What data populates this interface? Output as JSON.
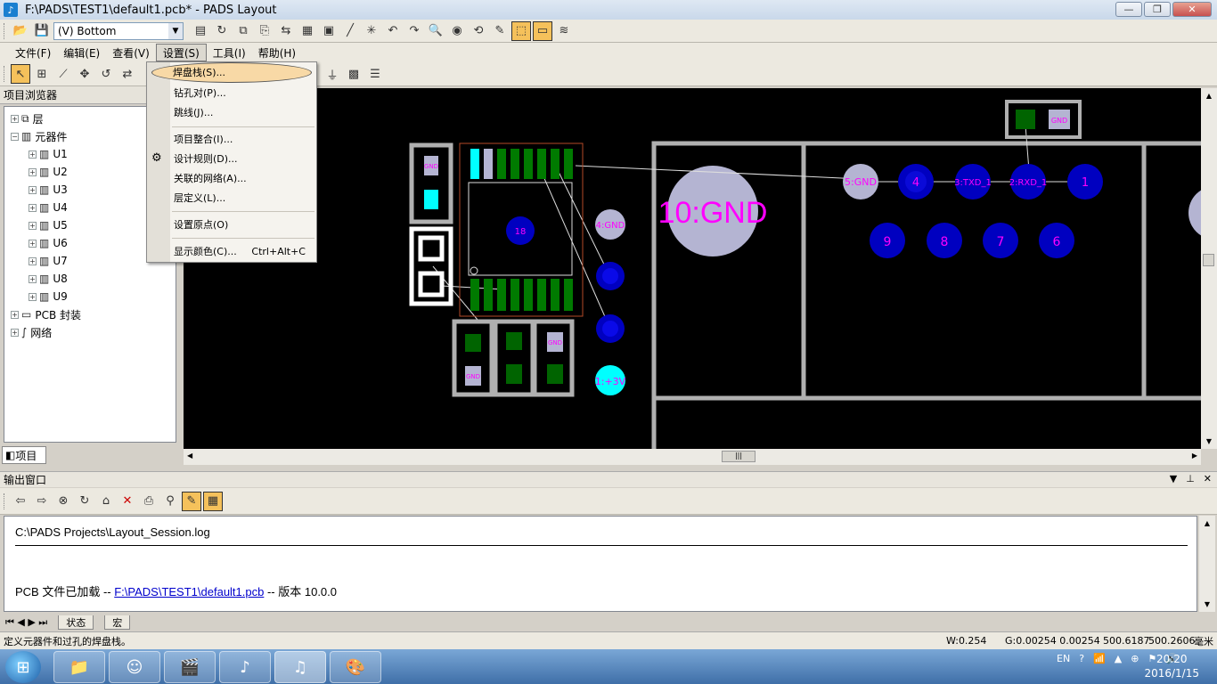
{
  "window": {
    "title": "F:\\PADS\\TEST1\\default1.pcb* - PADS Layout"
  },
  "toolbar": {
    "layer_select": "(V) Bottom"
  },
  "menubar": {
    "items": [
      "文件(F)",
      "编辑(E)",
      "查看(V)",
      "设置(S)",
      "工具(I)",
      "帮助(H)"
    ]
  },
  "settings_menu": {
    "items": [
      {
        "label": "焊盘栈(S)...",
        "shortcut": ""
      },
      {
        "label": "钻孔对(P)...",
        "shortcut": ""
      },
      {
        "label": "跳线(J)...",
        "shortcut": ""
      },
      {
        "label": "项目整合(I)...",
        "shortcut": ""
      },
      {
        "label": "设计规则(D)...",
        "shortcut": ""
      },
      {
        "label": "关联的网络(A)...",
        "shortcut": ""
      },
      {
        "label": "层定义(L)...",
        "shortcut": ""
      },
      {
        "label": "设置原点(O)",
        "shortcut": ""
      },
      {
        "label": "显示颜色(C)...",
        "shortcut": "Ctrl+Alt+C"
      }
    ]
  },
  "project_browser": {
    "title": "项目浏览器",
    "tab": "项目",
    "nodes": [
      {
        "label": "层"
      },
      {
        "label": "元器件"
      },
      {
        "label": "U1"
      },
      {
        "label": "U2"
      },
      {
        "label": "U3"
      },
      {
        "label": "U4"
      },
      {
        "label": "U5"
      },
      {
        "label": "U6"
      },
      {
        "label": "U7"
      },
      {
        "label": "U8"
      },
      {
        "label": "U9"
      },
      {
        "label": "PCB 封装"
      },
      {
        "label": "网络"
      }
    ]
  },
  "pcb": {
    "labels": {
      "gnd_big": "10:GND",
      "gnd5": "5:GND",
      "p4": "4",
      "txd": "3:TXD_1",
      "rxd": "2:RXD_1",
      "p1": "1",
      "p9": "9",
      "p8": "8",
      "p7": "7",
      "p6": "6",
      "gnd4": "4:GND",
      "v3": "1:+3V",
      "p18": "18",
      "gnd_small": "GND",
      "gnd_small2": "GND",
      "gnd_small3": "GND",
      "gnd_small4": "GND",
      "one_small": "1"
    },
    "colors": {
      "copper_green": "#006400",
      "pad_gray": "#b0b0b0",
      "via_blue": "#0000ff",
      "cyan": "#00ffff",
      "label_magenta": "#ff00ff"
    }
  },
  "output": {
    "title": "输出窗口",
    "log_path": "C:\\PADS Projects\\Layout_Session.log",
    "msg_prefix": "PCB 文件已加载  -- ",
    "msg_link": "F:\\PADS\\TEST1\\default1.pcb",
    "msg_suffix": " -- 版本  10.0.0",
    "tabs": [
      "状态",
      "宏"
    ]
  },
  "statusbar": {
    "message": "定义元器件和过孔的焊盘栈。",
    "width": "W:0.254",
    "grid": "G:0.00254 0.00254",
    "x": "500.6187",
    "y": "500.2606",
    "unit": "毫米"
  },
  "taskbar": {
    "lang": "EN",
    "time": "20:20",
    "date": "2016/1/15"
  }
}
